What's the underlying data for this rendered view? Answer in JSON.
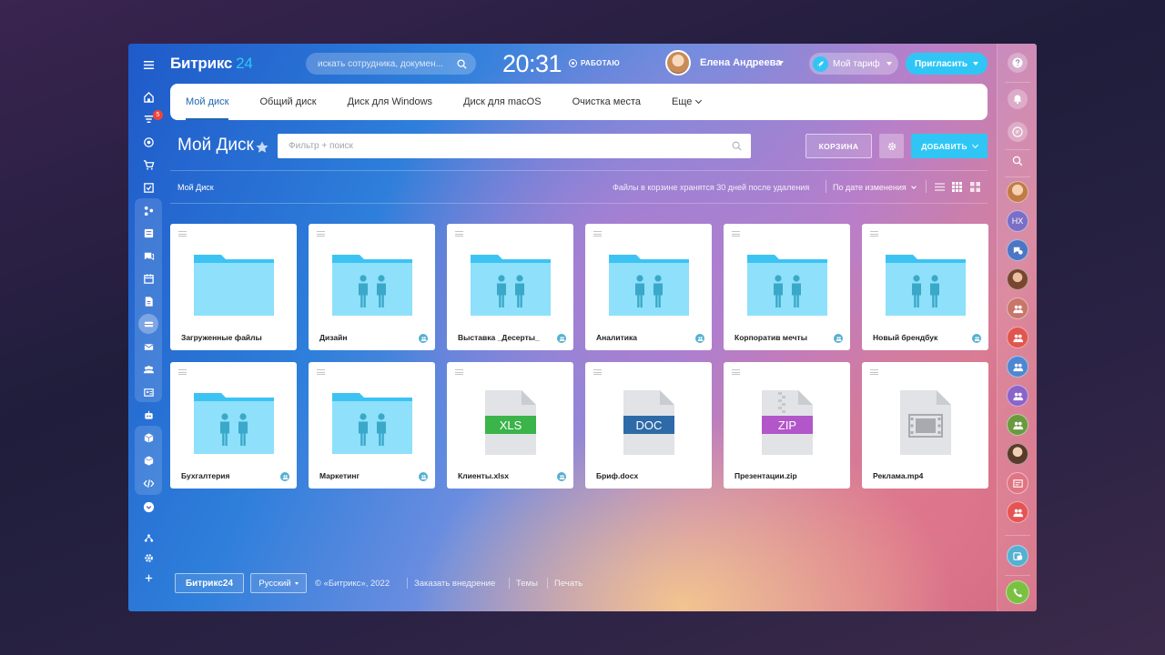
{
  "header": {
    "logo_name": "Битрикс",
    "logo_num": "24",
    "search_placeholder": "искать сотрудника, докумен...",
    "time": "20:31",
    "work_status": "РАБОТАЮ",
    "user_name": "Елена Андреева",
    "plan_label": "Мой тариф",
    "invite_label": "Пригласить"
  },
  "tabs": [
    {
      "label": "Мой диск",
      "active": true
    },
    {
      "label": "Общий диск"
    },
    {
      "label": "Диск для Windows"
    },
    {
      "label": "Диск для macOS"
    },
    {
      "label": "Очистка места"
    },
    {
      "label": "Еще"
    }
  ],
  "toolbar": {
    "title": "Мой Диск",
    "filter_placeholder": "Фильтр + поиск",
    "trash_label": "КОРЗИНА",
    "add_label": "ДОБАВИТЬ"
  },
  "subbar": {
    "breadcrumb": "Мой Диск",
    "trash_note": "Файлы в корзине хранятся 30 дней после удаления",
    "sort_label": "По дате изменения"
  },
  "items": [
    {
      "name": "Загруженные файлы",
      "kind": "folder",
      "shared": false
    },
    {
      "name": "Дизайн",
      "kind": "folder",
      "shared": true
    },
    {
      "name": "Выставка _Десерты_",
      "kind": "folder",
      "shared": true
    },
    {
      "name": "Аналитика",
      "kind": "folder",
      "shared": true
    },
    {
      "name": "Корпоратив мечты",
      "kind": "folder",
      "shared": true
    },
    {
      "name": "Новый брендбук",
      "kind": "folder",
      "shared": true
    },
    {
      "name": "Бухгалтерия",
      "kind": "folder",
      "shared": true
    },
    {
      "name": "Маркетинг",
      "kind": "folder",
      "shared": true
    },
    {
      "name": "Клиенты.xlsx",
      "kind": "file",
      "ext": "XLS",
      "shared": true
    },
    {
      "name": "Бриф.docx",
      "kind": "file",
      "ext": "DOC",
      "shared": false
    },
    {
      "name": "Презентации.zip",
      "kind": "file",
      "ext": "ZIP",
      "shared": false
    },
    {
      "name": "Реклама.mp4",
      "kind": "file",
      "ext": "",
      "shared": false
    }
  ],
  "left_rail": {
    "badge": "5"
  },
  "right_rail": {
    "initials": "НХ"
  },
  "footer": {
    "logo": "Битрикс24",
    "language": "Русский",
    "copyright": "© «Битрикс», 2022",
    "link_order": "Заказать внедрение",
    "link_themes": "Темы",
    "link_print": "Печать"
  },
  "colors": {
    "accent": "#2fc6f6",
    "tab_active": "#2067b0",
    "folder_back": "#3dc3f2",
    "folder_front": "#8ee0fb",
    "people": "#3aa8c9",
    "xls": "#3bb44a",
    "doc": "#2f6aa8",
    "zip": "#b256c9",
    "file_page": "#e1e3e6",
    "call_green": "#7ac142"
  }
}
